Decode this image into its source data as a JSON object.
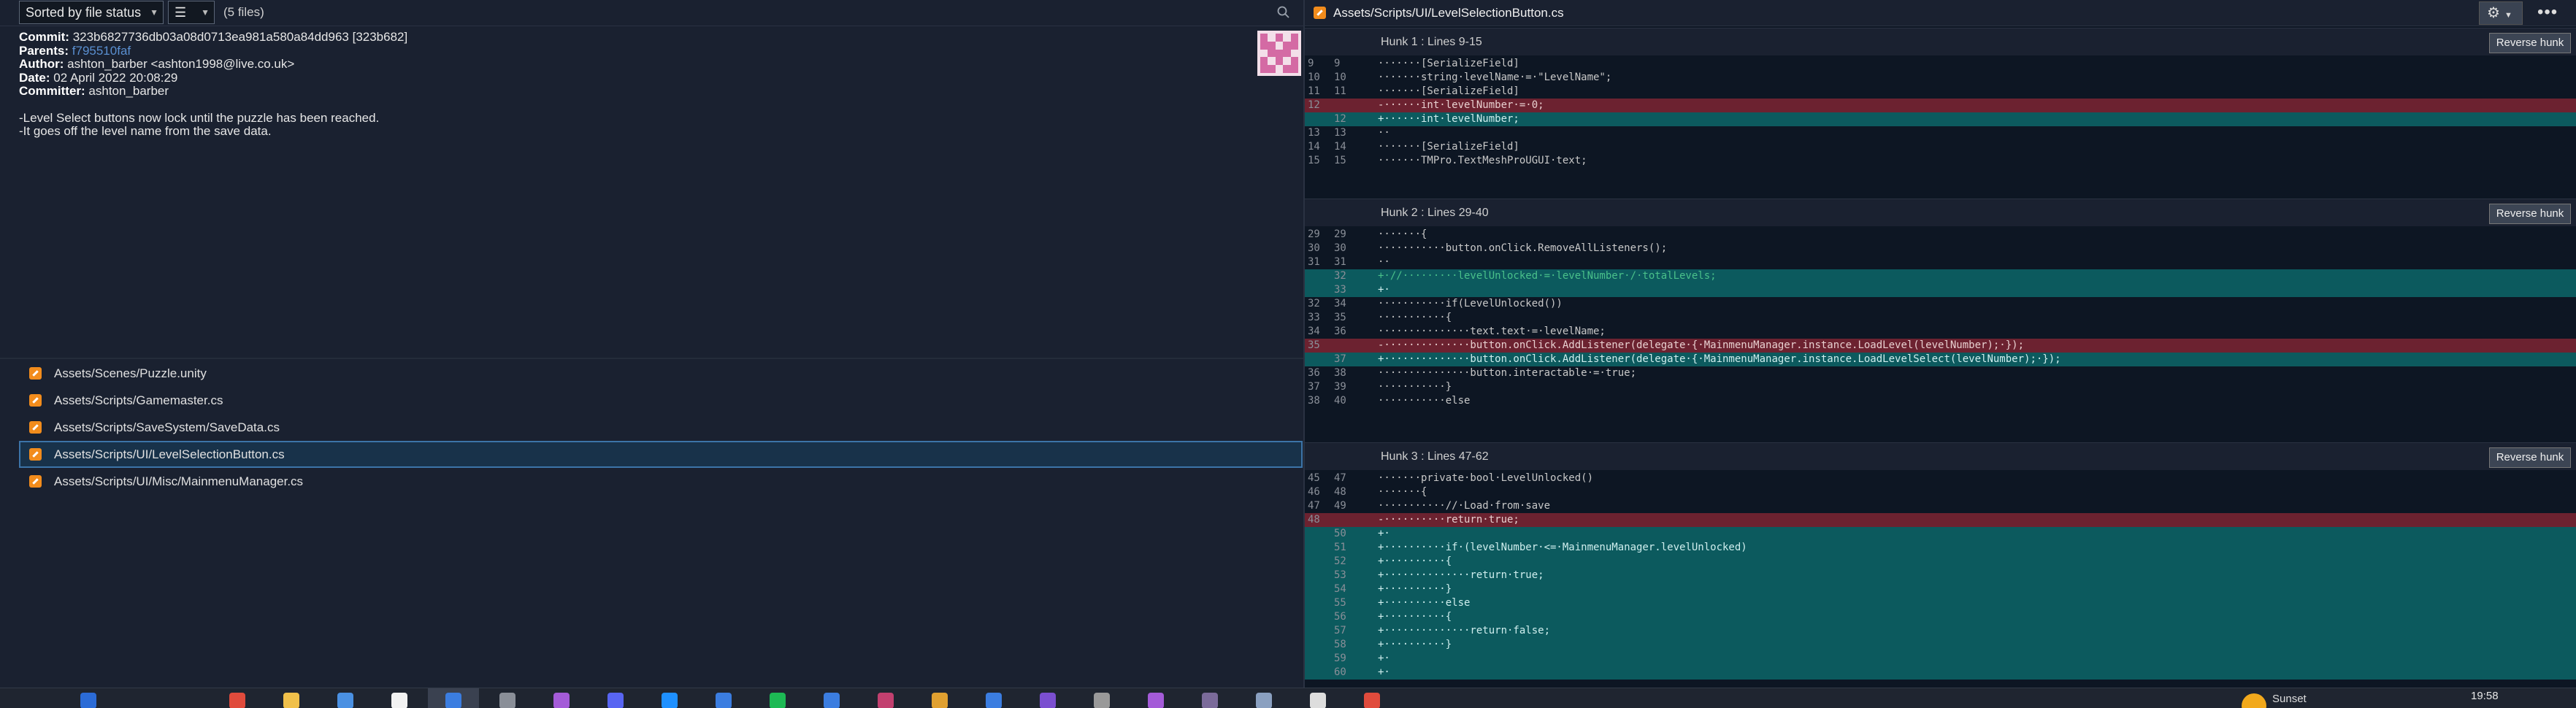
{
  "toolbar": {
    "sort_label": "Sorted by file status",
    "view_icon": "list-icon",
    "file_count": "(5 files)",
    "search_icon": "search-icon"
  },
  "commit": {
    "commit_label": "Commit:",
    "commit_value": "323b6827736db03a08d0713ea981a580a84dd963 [323b682]",
    "parents_label": "Parents:",
    "parents_value": "f795510faf",
    "author_label": "Author:",
    "author_value": "ashton_barber <ashton1998@live.co.uk>",
    "date_label": "Date:",
    "date_value": "02 April 2022 20:08:29",
    "committer_label": "Committer:",
    "committer_value": "ashton_barber",
    "message_line1": "-Level Select buttons now lock until the puzzle has been reached.",
    "message_line2": "-It goes off the level name from the save data."
  },
  "files": [
    {
      "path": "Assets/Scenes/Puzzle.unity"
    },
    {
      "path": "Assets/Scripts/Gamemaster.cs"
    },
    {
      "path": "Assets/Scripts/SaveSystem/SaveData.cs"
    },
    {
      "path": "Assets/Scripts/UI/LevelSelectionButton.cs"
    },
    {
      "path": "Assets/Scripts/UI/Misc/MainmenuManager.cs"
    }
  ],
  "diff": {
    "title": "Assets/Scripts/UI/LevelSelectionButton.cs",
    "reverse_label": "Reverse hunk",
    "hunks": [
      {
        "header": "Hunk 1 : Lines 9-15",
        "lines": [
          {
            "o": "9",
            "n": "9",
            "t": "ctx",
            "c": "·······[SerializeField]"
          },
          {
            "o": "10",
            "n": "10",
            "t": "ctx",
            "c": "·······string·levelName·=·\"LevelName\";"
          },
          {
            "o": "11",
            "n": "11",
            "t": "ctx",
            "c": "·······[SerializeField]"
          },
          {
            "o": "12",
            "n": "",
            "t": "del",
            "c": "-······int·levelNumber·=·0;"
          },
          {
            "o": "",
            "n": "12",
            "t": "add",
            "c": "+······int·levelNumber;"
          },
          {
            "o": "13",
            "n": "13",
            "t": "ctx",
            "c": "··"
          },
          {
            "o": "14",
            "n": "14",
            "t": "ctx",
            "c": "·······[SerializeField]"
          },
          {
            "o": "15",
            "n": "15",
            "t": "ctx",
            "c": "·······TMPro.TextMeshProUGUI·text;"
          }
        ]
      },
      {
        "header": "Hunk 2 : Lines 29-40",
        "lines": [
          {
            "o": "29",
            "n": "29",
            "t": "ctx",
            "c": "·······{"
          },
          {
            "o": "30",
            "n": "30",
            "t": "ctx",
            "c": "···········button.onClick.RemoveAllListeners();"
          },
          {
            "o": "31",
            "n": "31",
            "t": "ctx",
            "c": "··"
          },
          {
            "o": "",
            "n": "32",
            "t": "add",
            "c": "+·//·········levelUnlocked·=·levelNumber·/·totalLevels;",
            "cm": true
          },
          {
            "o": "",
            "n": "33",
            "t": "add",
            "c": "+·"
          },
          {
            "o": "32",
            "n": "34",
            "t": "ctx",
            "c": "···········if(LevelUnlocked())"
          },
          {
            "o": "33",
            "n": "35",
            "t": "ctx",
            "c": "···········{"
          },
          {
            "o": "34",
            "n": "36",
            "t": "ctx",
            "c": "···············text.text·=·levelName;"
          },
          {
            "o": "35",
            "n": "",
            "t": "del",
            "c": "-··············button.onClick.AddListener(delegate·{·MainmenuManager.instance.LoadLevel(levelNumber);·});"
          },
          {
            "o": "",
            "n": "37",
            "t": "add",
            "c": "+··············button.onClick.AddListener(delegate·{·MainmenuManager.instance.LoadLevelSelect(levelNumber);·});"
          },
          {
            "o": "36",
            "n": "38",
            "t": "ctx",
            "c": "···············button.interactable·=·true;"
          },
          {
            "o": "37",
            "n": "39",
            "t": "ctx",
            "c": "···········}"
          },
          {
            "o": "38",
            "n": "40",
            "t": "ctx",
            "c": "···········else"
          }
        ]
      },
      {
        "header": "Hunk 3 : Lines 47-62",
        "lines": [
          {
            "o": "45",
            "n": "47",
            "t": "ctx",
            "c": "·······private·bool·LevelUnlocked()"
          },
          {
            "o": "46",
            "n": "48",
            "t": "ctx",
            "c": "·······{"
          },
          {
            "o": "47",
            "n": "49",
            "t": "ctx",
            "c": "···········//·Load·from·save"
          },
          {
            "o": "48",
            "n": "",
            "t": "del",
            "c": "-··········return·true;"
          },
          {
            "o": "",
            "n": "50",
            "t": "add",
            "c": "+·"
          },
          {
            "o": "",
            "n": "51",
            "t": "add",
            "c": "+··········if·(levelNumber·<=·MainmenuManager.levelUnlocked)"
          },
          {
            "o": "",
            "n": "52",
            "t": "add",
            "c": "+··········{"
          },
          {
            "o": "",
            "n": "53",
            "t": "add",
            "c": "+··············return·true;"
          },
          {
            "o": "",
            "n": "54",
            "t": "add",
            "c": "+··········}"
          },
          {
            "o": "",
            "n": "55",
            "t": "add",
            "c": "+··········else"
          },
          {
            "o": "",
            "n": "56",
            "t": "add",
            "c": "+··········{"
          },
          {
            "o": "",
            "n": "57",
            "t": "add",
            "c": "+··············return·false;"
          },
          {
            "o": "",
            "n": "58",
            "t": "add",
            "c": "+··········}"
          },
          {
            "o": "",
            "n": "59",
            "t": "add",
            "c": "+·"
          },
          {
            "o": "",
            "n": "60",
            "t": "add",
            "c": "+·"
          }
        ]
      }
    ]
  },
  "taskbar": {
    "time": "19:58",
    "weather_text": "Sunset",
    "colors": [
      "#2b6bd6",
      "#e04b3c",
      "#f0c04a",
      "#4a90e2",
      "#f2f2f2",
      "#3b7de0",
      "#8a8f98",
      "#a45bd8",
      "#5865f2",
      "#1e90ff",
      "#3b7de0",
      "#1db954",
      "#3b7de0",
      "#c2406f",
      "#e0a030",
      "#3b7de0",
      "#7b4fd0",
      "#999",
      "#a45bd8",
      "#7b6b9a",
      "#8aa0c0",
      "#dddddd",
      "#e04b3c"
    ]
  }
}
